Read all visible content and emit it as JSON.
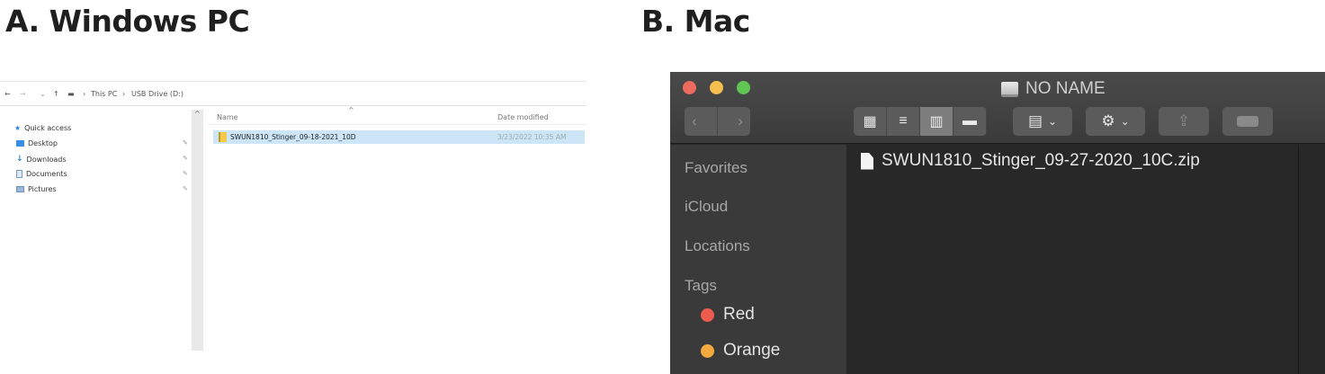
{
  "headings": {
    "windows": "A. Windows PC",
    "mac": "B. Mac"
  },
  "windows": {
    "breadcrumb": [
      "This PC",
      "USB Drive (D:)"
    ],
    "nav_items": [
      {
        "label": "Quick access",
        "icon": "star-icon"
      },
      {
        "label": "Desktop",
        "icon": "desktop-icon",
        "pinned": true
      },
      {
        "label": "Downloads",
        "icon": "download-icon",
        "pinned": true
      },
      {
        "label": "Documents",
        "icon": "document-icon",
        "pinned": true
      },
      {
        "label": "Pictures",
        "icon": "pictures-icon",
        "pinned": true
      }
    ],
    "columns": {
      "name": "Name",
      "date": "Date modified"
    },
    "file": {
      "name": "SWUN1810_Stinger_09-18-2021_10D",
      "date": "3/23/2022 10:35 AM"
    },
    "selection_color": "#cde6f7"
  },
  "mac": {
    "window_title": "NO NAME",
    "traffic_lights": [
      "#ed6a5e",
      "#f5bf4f",
      "#61c554"
    ],
    "sidebar": {
      "sections": [
        "Favorites",
        "iCloud",
        "Locations",
        "Tags"
      ],
      "tags": [
        {
          "label": "Red",
          "color": "#ee5b4f"
        },
        {
          "label": "Orange",
          "color": "#f3a93d"
        }
      ]
    },
    "file": {
      "name": "SWUN1810_Stinger_09-27-2020_10C.zip"
    }
  }
}
